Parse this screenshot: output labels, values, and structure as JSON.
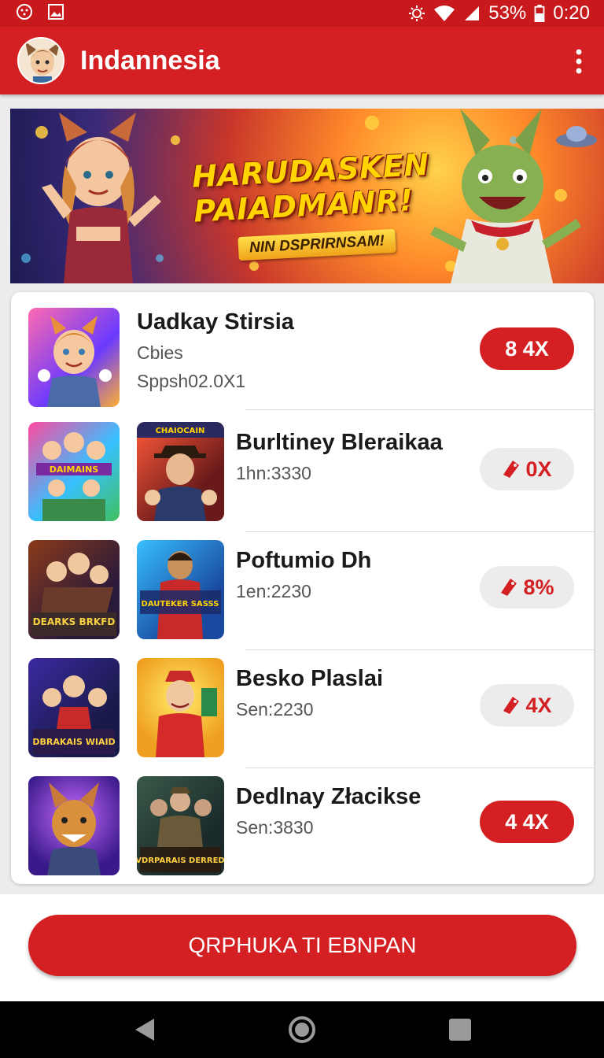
{
  "status_bar": {
    "battery": "53%",
    "time": "0:20"
  },
  "app_bar": {
    "title": "Indannesia"
  },
  "banner": {
    "headline": "HARUDASKEN PAIADMANR!",
    "subtitle": "NIN DSPRIRNSAM!"
  },
  "games": [
    {
      "title": "Uadkay Stirsia",
      "subtitle": "Cbies",
      "detail": "Sppsh02.0X1",
      "badge": "8 4X",
      "badge_style": "solid"
    },
    {
      "title": "Burltiney Bleraikaa",
      "subtitle": "1hn:3330",
      "badge": "0X",
      "badge_style": "soft",
      "thumb_texts": [
        "DAIMAINS",
        "CHAIOCAIN"
      ]
    },
    {
      "title": "Poftumio Dh",
      "subtitle": "1en:2230",
      "badge": "8%",
      "badge_style": "soft",
      "thumb_texts": [
        "DEARKS BRKFD",
        "DAUTEKER SASSS"
      ]
    },
    {
      "title": "Besko Plaslai",
      "subtitle": "Sen:2230",
      "badge": "4X",
      "badge_style": "soft",
      "thumb_texts": [
        "DBRAKAIS WIAID",
        ""
      ]
    },
    {
      "title": "Dedlnay Złacikse",
      "subtitle": "Sen:3830",
      "badge": "4 4X",
      "badge_style": "solid",
      "thumb_texts": [
        "",
        "VDRPARAIS DERRED"
      ]
    }
  ],
  "cta": {
    "label": "QRPHUKA TI EBNPAN"
  },
  "colors": {
    "brand_red": "#d42022",
    "status_red": "#c8191c"
  }
}
